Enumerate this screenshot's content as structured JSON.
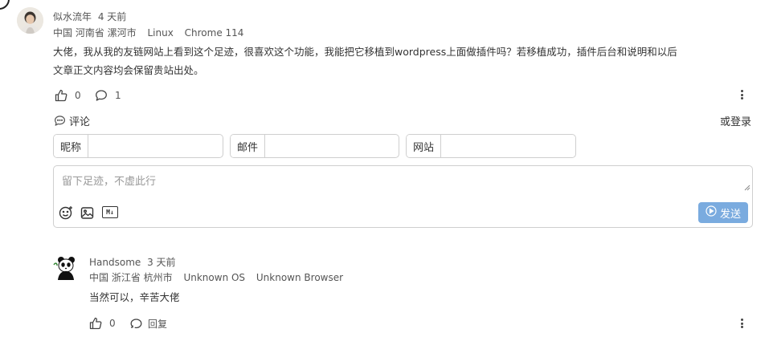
{
  "comment1": {
    "author": "似水流年",
    "time": "4 天前",
    "location": "中国 河南省 漯河市",
    "os": "Linux",
    "browser": "Chrome 114",
    "content_line1": "大佬，我从我的友链网站上看到这个足迹，很喜欢这个功能，我能把它移植到wordpress上面做插件吗？若移植成功，插件后台和说明和以后",
    "content_line2": "文章正文内容均会保留贵站出处。",
    "likes": "0",
    "replies": "1"
  },
  "reply_form": {
    "toggle_label": "评论",
    "login_label": "或登录",
    "nick_label": "昵称",
    "mail_label": "邮件",
    "site_label": "网站",
    "placeholder": "留下足迹，不虚此行",
    "md_label": "M↓",
    "send_label": "发送"
  },
  "reply1": {
    "author": "Handsome",
    "time": "3 天前",
    "location": "中国 浙江省 杭州市",
    "os": "Unknown OS",
    "browser": "Unknown Browser",
    "content": "当然可以，辛苦大佬",
    "likes": "0",
    "reply_label": "回复"
  },
  "icons": {
    "like": "thumbs-up-icon",
    "comment": "comment-bubble-icon",
    "more": "more-vertical-icon",
    "emoji": "emoji-icon",
    "image": "image-upload-icon",
    "markdown": "markdown-icon",
    "send": "play-circle-icon",
    "reply": "reply-icon"
  },
  "colors": {
    "send_button": "#7aabdf",
    "border": "#cfcfcf",
    "text": "#333333"
  }
}
